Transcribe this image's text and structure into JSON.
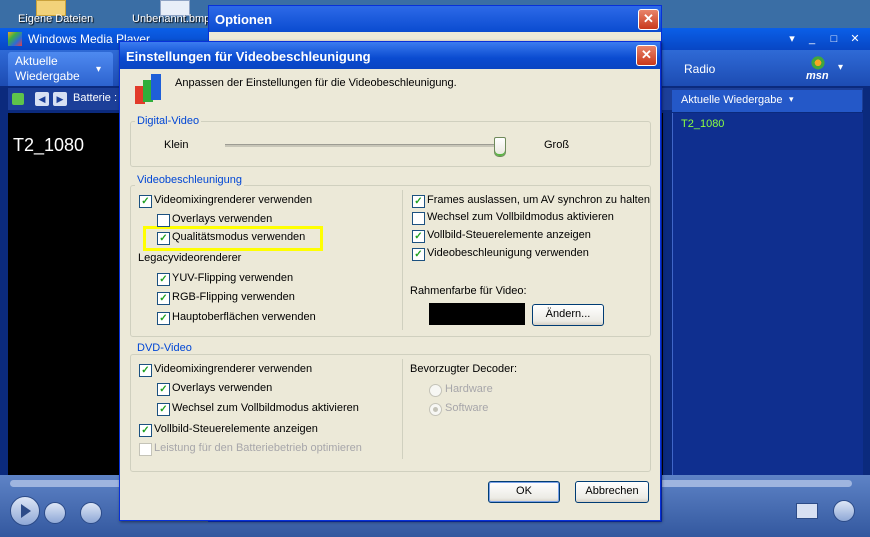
{
  "desktop": {
    "icons": [
      {
        "label": "Eigene Dateien"
      },
      {
        "label": "Unbenannt.bmp"
      }
    ]
  },
  "wmp": {
    "title": "Windows Media Player",
    "tab_label": "Aktuelle\nWiedergabe",
    "tab_line1": "Aktuelle",
    "tab_line2": "Wiedergabe",
    "radio_label": "Radio",
    "msn_label": "msn",
    "battery_label": "Batterie :",
    "video_title": "T2_1080",
    "playlist_header": "Aktuelle Wiedergabe",
    "playlist_items": [
      "T2_1080"
    ]
  },
  "options_dialog": {
    "title": "Optionen"
  },
  "dialog": {
    "title": "Einstellungen für Videobeschleunigung",
    "description": "Anpassen der Einstellungen für die Videobeschleunigung.",
    "digital_video": {
      "group_label": "Digital-Video",
      "slider_min_label": "Klein",
      "slider_max_label": "Groß",
      "slider_level": 0.99
    },
    "video_accel": {
      "group_label": "Videobeschleunigung",
      "left": [
        {
          "label": "Videomixingrenderer verwenden",
          "checked": true
        },
        {
          "label": "Overlays verwenden",
          "checked": false
        },
        {
          "label": "Qualitätsmodus verwenden",
          "checked": true,
          "highlighted": true
        }
      ],
      "legacy_label": "Legacyvideorenderer",
      "legacy": [
        {
          "label": "YUV-Flipping verwenden",
          "checked": true
        },
        {
          "label": "RGB-Flipping verwenden",
          "checked": true
        },
        {
          "label": "Hauptoberflächen verwenden",
          "checked": true
        }
      ],
      "right": [
        {
          "label": "Frames auslassen, um AV synchron zu halten",
          "checked": true
        },
        {
          "label": "Wechsel zum Vollbildmodus aktivieren",
          "checked": false
        },
        {
          "label": "Vollbild-Steuerelemente anzeigen",
          "checked": true
        },
        {
          "label": "Videobeschleunigung verwenden",
          "checked": true
        }
      ],
      "frame_color_label": "Rahmenfarbe für Video:",
      "frame_color": "#000000",
      "change_button": "Ändern..."
    },
    "dvd_video": {
      "group_label": "DVD-Video",
      "items": [
        {
          "label": "Videomixingrenderer verwenden",
          "checked": true
        },
        {
          "label": "Overlays verwenden",
          "checked": true
        },
        {
          "label": "Wechsel zum Vollbildmodus aktivieren",
          "checked": true
        },
        {
          "label": "Vollbild-Steuerelemente anzeigen",
          "checked": true
        },
        {
          "label": "Leistung für den Batteriebetrieb optimieren",
          "checked": false,
          "disabled": true
        }
      ],
      "decoder_label": "Bevorzugter Decoder:",
      "decoder_options": [
        {
          "label": "Hardware",
          "selected": false
        },
        {
          "label": "Software",
          "selected": true
        }
      ]
    },
    "ok_button": "OK",
    "cancel_button": "Abbrechen"
  },
  "colors": {
    "highlight": "#ffff00",
    "group_label": "#0046d5",
    "title_bar": "#0a4bd0"
  }
}
